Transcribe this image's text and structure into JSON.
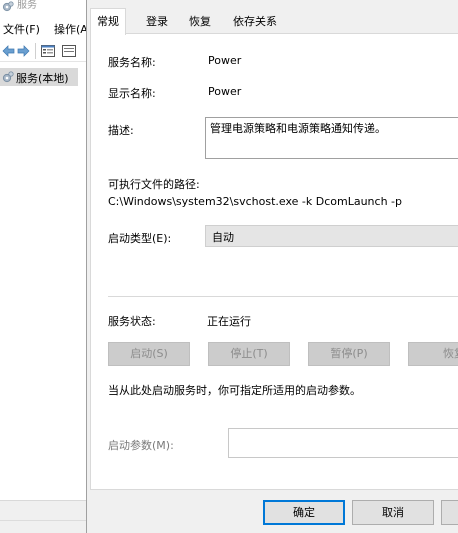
{
  "mmc": {
    "title": "服务",
    "menu": [
      "文件(F)",
      "操作(A"
    ],
    "tree_item": "服务(本地)"
  },
  "dialog": {
    "tabs": [
      "常规",
      "登录",
      "恢复",
      "依存关系"
    ],
    "active_tab": "常规",
    "general": {
      "service_name_label": "服务名称:",
      "service_name": "Power",
      "display_name_label": "显示名称:",
      "display_name": "Power",
      "description_label": "描述:",
      "description": "管理电源策略和电源策略通知传递。",
      "exe_path_label": "可执行文件的路径:",
      "exe_path": "C:\\Windows\\system32\\svchost.exe -k DcomLaunch -p",
      "startup_type_label": "启动类型(E):",
      "startup_type": "自动",
      "service_status_label": "服务状态:",
      "service_status": "正在运行",
      "control_buttons": [
        "启动(S)",
        "停止(T)",
        "暂停(P)",
        "恢复"
      ],
      "start_hint": "当从此处启动服务时，你可指定所适用的启动参数。",
      "start_params_label": "启动参数(M):",
      "start_params_value": ""
    },
    "footer_buttons": {
      "ok": "确定",
      "cancel": "取消"
    }
  }
}
